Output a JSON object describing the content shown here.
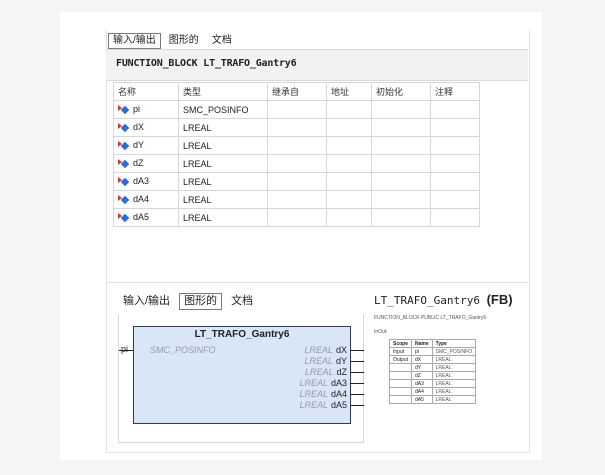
{
  "top_tabs": [
    "输入/输出",
    "图形的",
    "文档"
  ],
  "function_block_header": "FUNCTION_BLOCK LT_TRAFO_Gantry6",
  "var_table": {
    "columns": [
      "名称",
      "类型",
      "继承自",
      "地址",
      "初始化",
      "注释"
    ],
    "rows": [
      {
        "name": "pi",
        "type": "SMC_POSINFO"
      },
      {
        "name": "dX",
        "type": "LREAL"
      },
      {
        "name": "dY",
        "type": "LREAL"
      },
      {
        "name": "dZ",
        "type": "LREAL"
      },
      {
        "name": "dA3",
        "type": "LREAL"
      },
      {
        "name": "dA4",
        "type": "LREAL"
      },
      {
        "name": "dA5",
        "type": "LREAL"
      }
    ]
  },
  "bottom_tabs": [
    "输入/输出",
    "图形的",
    "文档"
  ],
  "fb_graphic": {
    "title": "LT_TRAFO_Gantry6",
    "input": {
      "name": "pi",
      "type": "SMC_POSINFO"
    },
    "outputs": [
      {
        "name": "dX",
        "type": "LREAL"
      },
      {
        "name": "dY",
        "type": "LREAL"
      },
      {
        "name": "dZ",
        "type": "LREAL"
      },
      {
        "name": "dA3",
        "type": "LREAL"
      },
      {
        "name": "dA4",
        "type": "LREAL"
      },
      {
        "name": "dA5",
        "type": "LREAL"
      }
    ]
  },
  "doc_panel": {
    "title": "LT_TRAFO_Gantry6",
    "suffix": "(FB)",
    "declaration": "FUNCTION_BLOCK PUBLIC LT_TRAFO_Gantry6",
    "section": "InOut:",
    "table_headers": [
      "Scope",
      "Name",
      "Type"
    ],
    "rows": [
      {
        "scope": "Input",
        "name": "pi",
        "type": "SMC_POSINFO"
      },
      {
        "scope": "Output",
        "name": "dX",
        "type": "LREAL"
      },
      {
        "scope": "",
        "name": "dY",
        "type": "LREAL"
      },
      {
        "scope": "",
        "name": "dZ",
        "type": "LREAL"
      },
      {
        "scope": "",
        "name": "dA3",
        "type": "LREAL"
      },
      {
        "scope": "",
        "name": "dA4",
        "type": "LREAL"
      },
      {
        "scope": "",
        "name": "dA5",
        "type": "LREAL"
      }
    ]
  },
  "colors": {
    "fb_fill": "#d8e6f8",
    "input_arrow": "#d43a2f",
    "var_diamond": "#2a6fd6"
  }
}
